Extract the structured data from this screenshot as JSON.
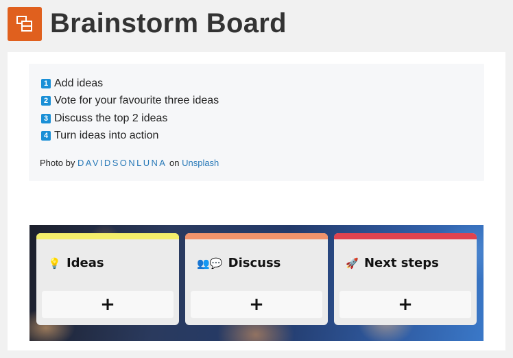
{
  "header": {
    "title": "Brainstorm Board",
    "icon": "board-icon",
    "icon_color": "#e0601e"
  },
  "instructions": {
    "steps": [
      {
        "num": "1",
        "text": "Add ideas"
      },
      {
        "num": "2",
        "text": "Vote for your favourite three ideas"
      },
      {
        "num": "3",
        "text": "Discuss the top 2 ideas"
      },
      {
        "num": "4",
        "text": "Turn ideas into action"
      }
    ],
    "credit": {
      "prefix": "Photo by",
      "author": "DAVIDSONLUNA",
      "middle": "on",
      "site": "Unsplash"
    }
  },
  "board": {
    "columns": [
      {
        "title": "Ideas",
        "icons": "💡",
        "bar_color": "#f4ee6b",
        "add_label": "+"
      },
      {
        "title": "Discuss",
        "icons": "👥💬",
        "bar_color": "#f1936b",
        "add_label": "+"
      },
      {
        "title": "Next steps",
        "icons": "🚀",
        "bar_color": "#e0434f",
        "add_label": "+"
      }
    ]
  }
}
